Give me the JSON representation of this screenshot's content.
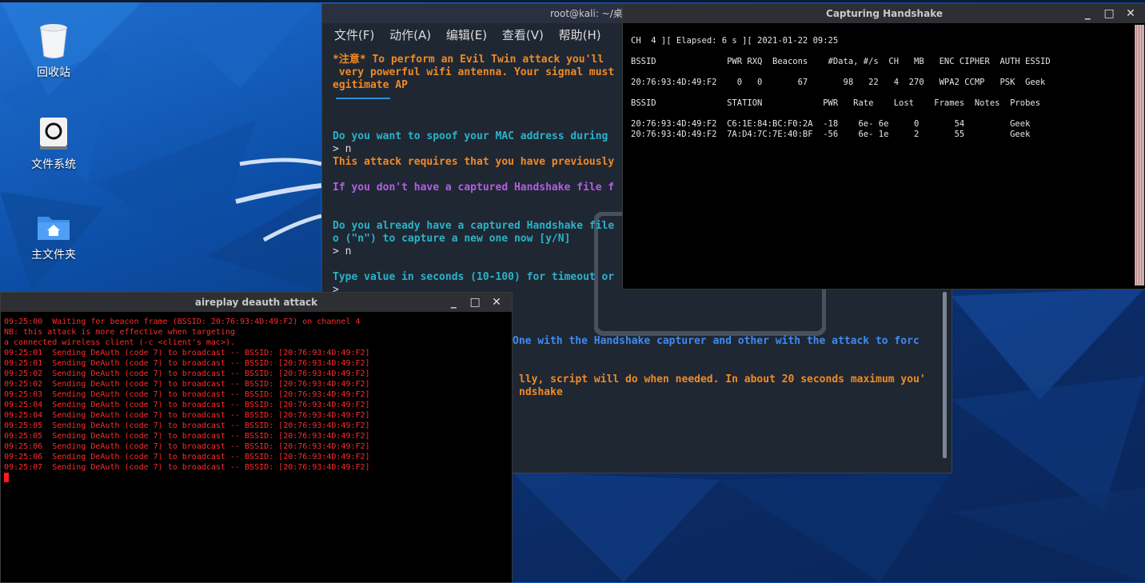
{
  "desktop": {
    "icons": [
      {
        "label": "回收站",
        "icon": "trash-icon"
      },
      {
        "label": "文件系统",
        "icon": "drive-icon"
      },
      {
        "label": "主文件夹",
        "icon": "home-folder-icon"
      }
    ]
  },
  "main_terminal": {
    "title": "root@kali: ~/桌面",
    "menu": [
      "文件(F)",
      "动作(A)",
      "编辑(E)",
      "查看(V)",
      "帮助(H)"
    ],
    "lines": [
      {
        "text": "*注意* To perform an Evil Twin attack you'll",
        "color": "orange"
      },
      {
        "text": " very powerful wifi antenna. Your signal must",
        "color": "orange"
      },
      {
        "text": "egitimate AP",
        "color": "orange"
      },
      {
        "text": "Do you want to spoof your MAC address during",
        "color": "cyan"
      },
      {
        "text": "> n",
        "color": "white"
      },
      {
        "text": "This attack requires that you have previously",
        "color": "orange"
      },
      {
        "text": "If you don't have a captured Handshake file f",
        "color": "purple"
      },
      {
        "text": "Do you already have a captured Handshake file",
        "color": "cyan"
      },
      {
        "text": "o (\"n\") to capture a new one now [y/N]",
        "color": "cyan"
      },
      {
        "text": "> n",
        "color": "white"
      },
      {
        "text": "Type value in seconds (10-100) for timeout or",
        "color": "cyan"
      },
      {
        "text": ">",
        "color": "white"
      },
      {
        "text": "One with the Handshake capturer and other with the attack to forc",
        "color": "blue"
      },
      {
        "text": "lly, script will do when needed. In about 20 seconds maximum you'",
        "color": "orange"
      },
      {
        "text": "ndshake",
        "color": "orange"
      }
    ]
  },
  "capture_window": {
    "title": "Capturing Handshake",
    "status_line": "CH  4 ][ Elapsed: 6 s ][ 2021-01-22 09:25",
    "ap_header": "BSSID              PWR RXQ  Beacons    #Data, #/s  CH   MB   ENC CIPHER  AUTH ESSID",
    "ap_rows": [
      "20:76:93:4D:49:F2    0   0       67       98   22   4  270   WPA2 CCMP   PSK  Geek"
    ],
    "station_header": "BSSID              STATION            PWR   Rate    Lost    Frames  Notes  Probes",
    "station_rows": [
      "20:76:93:4D:49:F2  C6:1E:84:BC:F0:2A  -18    6e- 6e     0       54         Geek",
      "20:76:93:4D:49:F2  7A:D4:7C:7E:40:BF  -56    6e- 1e     2       55         Geek"
    ]
  },
  "aireplay_window": {
    "title": "aireplay deauth attack",
    "lines": [
      "09:25:00  Waiting for beacon frame (BSSID: 20:76:93:4D:49:F2) on channel 4",
      "NB: this attack is more effective when targeting",
      "a connected wireless client (-c <client's mac>).",
      "09:25:01  Sending DeAuth (code 7) to broadcast -- BSSID: [20:76:93:4D:49:F2]",
      "09:25:01  Sending DeAuth (code 7) to broadcast -- BSSID: [20:76:93:4D:49:F2]",
      "09:25:02  Sending DeAuth (code 7) to broadcast -- BSSID: [20:76:93:4D:49:F2]",
      "09:25:02  Sending DeAuth (code 7) to broadcast -- BSSID: [20:76:93:4D:49:F2]",
      "09:25:03  Sending DeAuth (code 7) to broadcast -- BSSID: [20:76:93:4D:49:F2]",
      "09:25:04  Sending DeAuth (code 7) to broadcast -- BSSID: [20:76:93:4D:49:F2]",
      "09:25:04  Sending DeAuth (code 7) to broadcast -- BSSID: [20:76:93:4D:49:F2]",
      "09:25:05  Sending DeAuth (code 7) to broadcast -- BSSID: [20:76:93:4D:49:F2]",
      "09:25:05  Sending DeAuth (code 7) to broadcast -- BSSID: [20:76:93:4D:49:F2]",
      "09:25:06  Sending DeAuth (code 7) to broadcast -- BSSID: [20:76:93:4D:49:F2]",
      "09:25:06  Sending DeAuth (code 7) to broadcast -- BSSID: [20:76:93:4D:49:F2]",
      "09:25:07  Sending DeAuth (code 7) to broadcast -- BSSID: [20:76:93:4D:49:F2]"
    ]
  },
  "window_buttons": {
    "minimize": "_",
    "maximize": "□",
    "close": "✕"
  }
}
